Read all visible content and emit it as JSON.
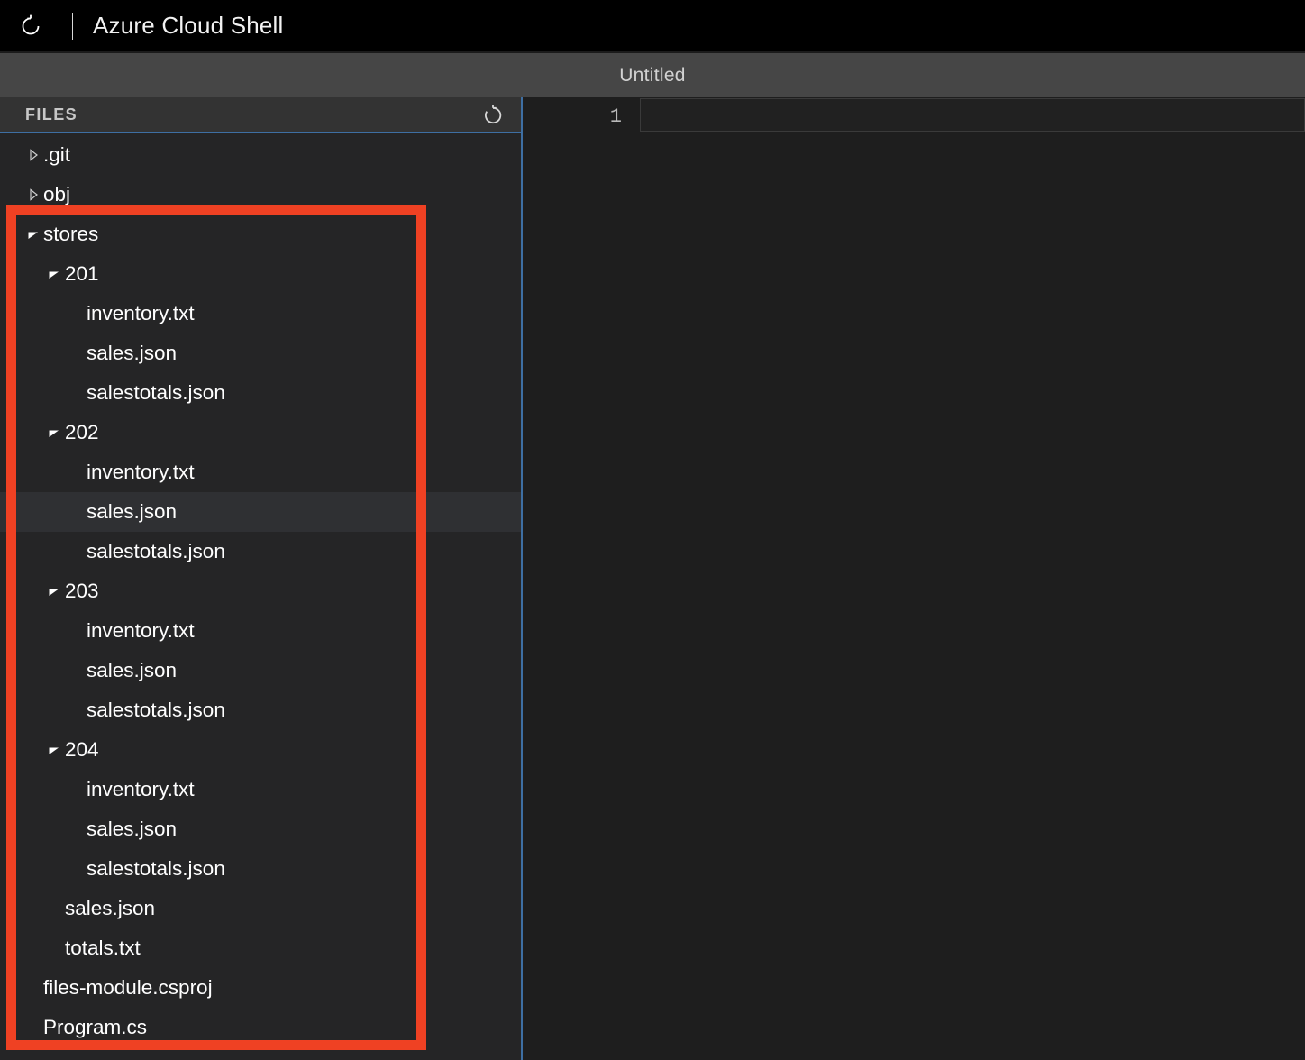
{
  "titlebar": {
    "restart_icon": "restart-icon",
    "app_title": "Azure Cloud Shell"
  },
  "editor": {
    "tab_title": "Untitled",
    "line_number": "1",
    "content": ""
  },
  "sidebar": {
    "header_label": "FILES",
    "refresh_icon": "refresh-icon",
    "tree": [
      {
        "label": ".git",
        "depth": 0,
        "type": "folder",
        "state": "collapsed",
        "selected": false
      },
      {
        "label": "obj",
        "depth": 0,
        "type": "folder",
        "state": "collapsed",
        "selected": false
      },
      {
        "label": "stores",
        "depth": 0,
        "type": "folder",
        "state": "expanded",
        "selected": false
      },
      {
        "label": "201",
        "depth": 1,
        "type": "folder",
        "state": "expanded",
        "selected": false
      },
      {
        "label": "inventory.txt",
        "depth": 2,
        "type": "file",
        "state": "none",
        "selected": false
      },
      {
        "label": "sales.json",
        "depth": 2,
        "type": "file",
        "state": "none",
        "selected": false
      },
      {
        "label": "salestotals.json",
        "depth": 2,
        "type": "file",
        "state": "none",
        "selected": false
      },
      {
        "label": "202",
        "depth": 1,
        "type": "folder",
        "state": "expanded",
        "selected": false
      },
      {
        "label": "inventory.txt",
        "depth": 2,
        "type": "file",
        "state": "none",
        "selected": false
      },
      {
        "label": "sales.json",
        "depth": 2,
        "type": "file",
        "state": "none",
        "selected": true
      },
      {
        "label": "salestotals.json",
        "depth": 2,
        "type": "file",
        "state": "none",
        "selected": false
      },
      {
        "label": "203",
        "depth": 1,
        "type": "folder",
        "state": "expanded",
        "selected": false
      },
      {
        "label": "inventory.txt",
        "depth": 2,
        "type": "file",
        "state": "none",
        "selected": false
      },
      {
        "label": "sales.json",
        "depth": 2,
        "type": "file",
        "state": "none",
        "selected": false
      },
      {
        "label": "salestotals.json",
        "depth": 2,
        "type": "file",
        "state": "none",
        "selected": false
      },
      {
        "label": "204",
        "depth": 1,
        "type": "folder",
        "state": "expanded",
        "selected": false
      },
      {
        "label": "inventory.txt",
        "depth": 2,
        "type": "file",
        "state": "none",
        "selected": false
      },
      {
        "label": "sales.json",
        "depth": 2,
        "type": "file",
        "state": "none",
        "selected": false
      },
      {
        "label": "salestotals.json",
        "depth": 2,
        "type": "file",
        "state": "none",
        "selected": false
      },
      {
        "label": "sales.json",
        "depth": 1,
        "type": "file",
        "state": "none",
        "selected": false
      },
      {
        "label": "totals.txt",
        "depth": 1,
        "type": "file",
        "state": "none",
        "selected": false
      },
      {
        "label": "files-module.csproj",
        "depth": 0,
        "type": "file",
        "state": "none",
        "selected": false
      },
      {
        "label": "Program.cs",
        "depth": 0,
        "type": "file",
        "state": "none",
        "selected": false
      }
    ]
  },
  "annotation": {
    "name": "stores-folder-highlight",
    "color": "#ef4123"
  },
  "colors": {
    "titlebar_bg": "#000000",
    "tabstrip_bg": "#464646",
    "sidebar_bg": "#252526",
    "editor_bg": "#1e1e1e",
    "divider_blue": "#3e6fa3",
    "selected_row": "#2f3033",
    "text_primary": "#ffffff"
  }
}
